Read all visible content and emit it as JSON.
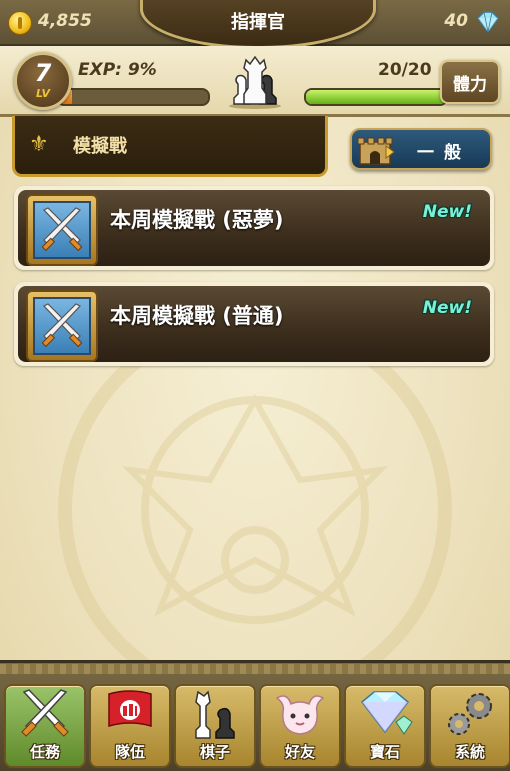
{
  "header": {
    "gold": "4,855",
    "title": "指揮官",
    "gems": "40"
  },
  "status": {
    "level": "7",
    "level_label": "LV",
    "exp_label": "EXP: 9%",
    "exp_progress": 0.09,
    "stamina": "20/20",
    "stamina_progress": 1.0,
    "stamina_button": "體力"
  },
  "section": {
    "title": "模擬戰",
    "mode_label": "一般"
  },
  "missions": [
    {
      "title": "本周模擬戰 (惡夢)",
      "badge": "New!"
    },
    {
      "title": "本周模擬戰 (普通)",
      "badge": "New!"
    }
  ],
  "nav": [
    {
      "label": "任務",
      "icon": "crossed-swords-icon",
      "active": true
    },
    {
      "label": "隊伍",
      "icon": "flag-icon",
      "active": false
    },
    {
      "label": "棋子",
      "icon": "chess-pieces-icon",
      "active": false
    },
    {
      "label": "好友",
      "icon": "creature-icon",
      "active": false
    },
    {
      "label": "寶石",
      "icon": "gem-icon",
      "active": false
    },
    {
      "label": "系統",
      "icon": "gears-icon",
      "active": false
    }
  ]
}
